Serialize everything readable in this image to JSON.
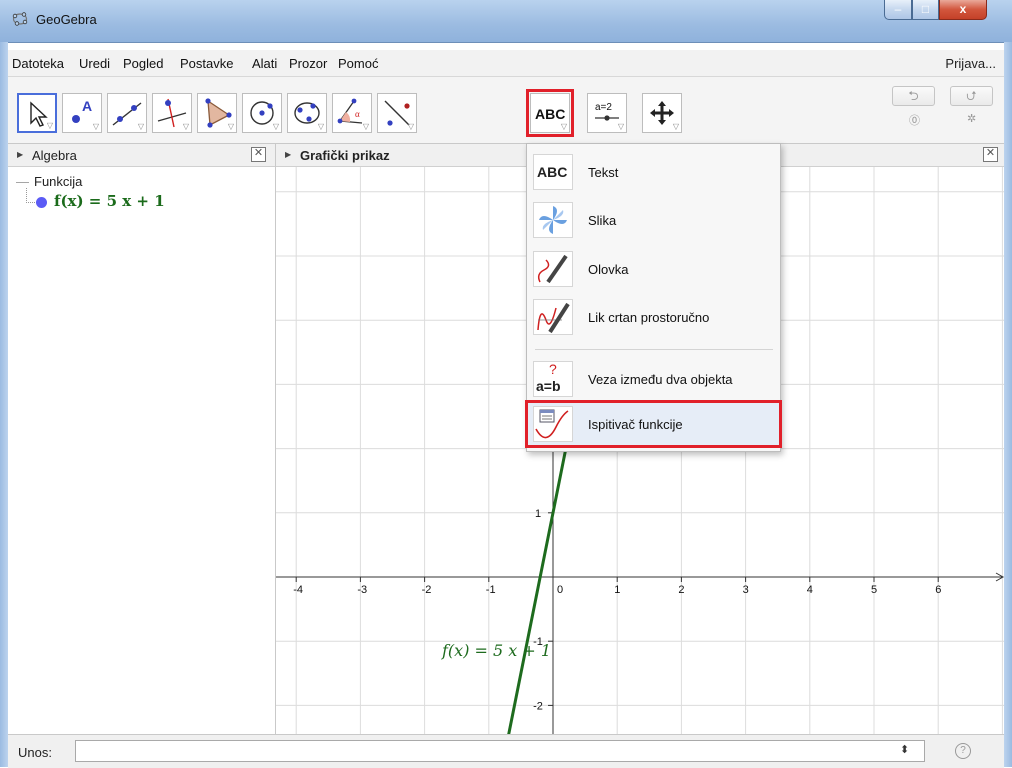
{
  "window": {
    "title": "GeoGebra",
    "controls": {
      "minimize": "–",
      "maximize": "□",
      "close": "x"
    }
  },
  "menu": {
    "items": [
      "Datoteka",
      "Uredi",
      "Pogled",
      "Postavke",
      "Alati",
      "Prozor",
      "Pomoć"
    ],
    "login": "Prijava..."
  },
  "toolbar": {
    "tools": [
      {
        "name": "move-tool",
        "icon": "cursor-arrow-icon",
        "selected": true
      },
      {
        "name": "point-tool",
        "icon": "point-a-icon"
      },
      {
        "name": "line-tool",
        "icon": "line-through-points-icon"
      },
      {
        "name": "perpendicular-tool",
        "icon": "perpendicular-line-icon"
      },
      {
        "name": "polygon-tool",
        "icon": "polygon-icon"
      },
      {
        "name": "circle-tool",
        "icon": "circle-center-icon"
      },
      {
        "name": "conic-tool",
        "icon": "ellipse-icon"
      },
      {
        "name": "angle-tool",
        "icon": "angle-icon"
      },
      {
        "name": "reflect-tool",
        "icon": "reflect-icon"
      },
      {
        "name": "text-tool",
        "icon": "abc-icon",
        "label": "ABC",
        "highlighted": true
      },
      {
        "name": "slider-tool",
        "icon": "slider-icon",
        "label": "a=2"
      },
      {
        "name": "move-graphics-tool",
        "icon": "move-arrows-icon"
      }
    ],
    "undo_icon": "undo-icon",
    "redo_icon": "redo-icon",
    "help_icon": "help-icon",
    "settings_icon": "gear-icon"
  },
  "algebra": {
    "title": "Algebra",
    "category": "Funkcija",
    "item": "f(x) = 5 x + 1"
  },
  "graphics": {
    "title": "Grafički prikaz",
    "function_label": "f(x)  =  5 x + 1"
  },
  "dropdown": {
    "items": [
      {
        "label": "Tekst",
        "icon": "abc-icon"
      },
      {
        "label": "Slika",
        "icon": "pinwheel-image-icon"
      },
      {
        "label": "Olovka",
        "icon": "pen-icon"
      },
      {
        "label": "Lik crtan prostoručno",
        "icon": "freehand-shape-icon"
      },
      {
        "label": "Veza između dva objekta",
        "icon": "relation-icon"
      },
      {
        "label": "Ispitivač funkcije",
        "icon": "function-inspector-icon",
        "highlighted": true
      }
    ]
  },
  "input": {
    "label": "Unos:",
    "value": ""
  },
  "chart_data": {
    "type": "line",
    "series": [
      {
        "name": "f(x) = 5 x + 1",
        "slope": 5,
        "intercept": 1
      }
    ],
    "xlim": [
      -4.5,
      7
    ],
    "ylim": [
      -2.5,
      6.5
    ],
    "x_ticks": [
      -4,
      -3,
      -2,
      -1,
      0,
      1,
      2,
      3,
      4,
      5,
      6
    ],
    "y_ticks": [
      -2,
      -1,
      1
    ],
    "grid": true,
    "line_color": "#1e6b1e",
    "accent": "#e1202a"
  }
}
